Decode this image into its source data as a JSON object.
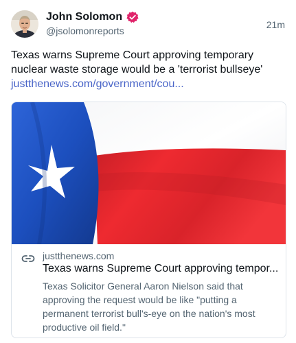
{
  "author": {
    "name": "John Solomon",
    "handle": "@jsolomonreports",
    "verified_color": "#e0246a"
  },
  "timestamp": "21m",
  "post": {
    "text_line1": "Texas warns Supreme Court approving temporary",
    "text_line2": "nuclear waste storage would be a 'terrorist bullseye'",
    "link": "justthenews.com/government/cou..."
  },
  "card": {
    "image_icon": "texas-flag",
    "link_icon": "link-icon",
    "domain": "justthenews.com",
    "title": "Texas warns Supreme Court approving tempor...",
    "desc_line1": "Texas Solicitor General Aaron Nielson said that",
    "desc_line2": "approving the request would be like \"putting a",
    "desc_line3": "permanent terrorist bull's-eye on the nation's most",
    "desc_line4": "productive oil field.\""
  },
  "colors": {
    "text": "#0f1419",
    "secondary": "#536471",
    "link": "#4a65c8",
    "flag_blue": "#1d56c9",
    "flag_red": "#e6262c"
  }
}
